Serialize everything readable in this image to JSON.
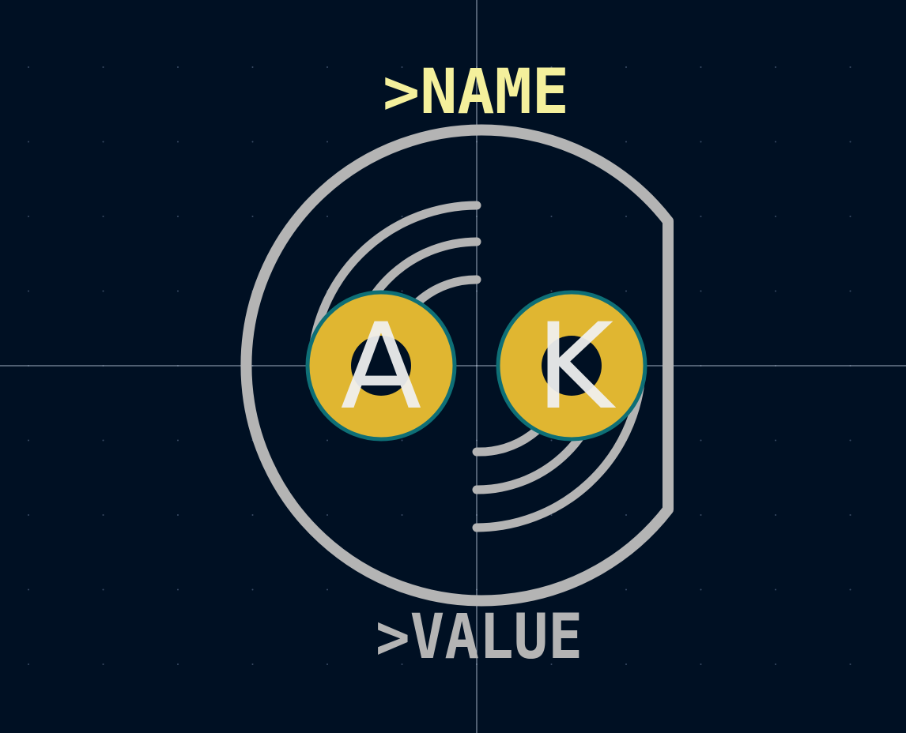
{
  "footprint": {
    "name_label": ">NAME",
    "value_label": ">VALUE"
  },
  "pads": [
    {
      "label": "A"
    },
    {
      "label": "K"
    }
  ],
  "colors": {
    "background": "#001023",
    "silkscreen": "#b4b4b4",
    "name_text": "#f4f09c",
    "pad_copper": "#e0b631",
    "pad_outline": "#0e6f76",
    "crosshair": "#c8d6e8"
  }
}
